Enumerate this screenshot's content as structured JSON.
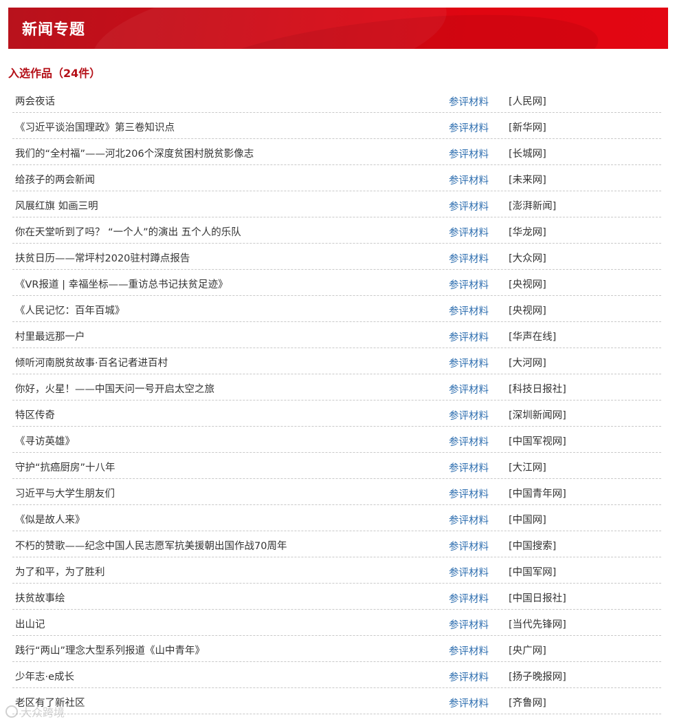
{
  "header": {
    "title": "新闻专题"
  },
  "section": {
    "title": "入选作品（24件）"
  },
  "items": [
    {
      "title": "两会夜话",
      "ref_label": "参评材料",
      "source": "[人民网]"
    },
    {
      "title": "《习近平谈治国理政》第三卷知识点",
      "ref_label": "参评材料",
      "source": "[新华网]"
    },
    {
      "title": "我们的“全村福”——河北206个深度贫困村脱贫影像志",
      "ref_label": "参评材料",
      "source": "[长城网]"
    },
    {
      "title": "给孩子的两会新闻",
      "ref_label": "参评材料",
      "source": "[未来网]"
    },
    {
      "title": "风展红旗 如画三明",
      "ref_label": "参评材料",
      "source": "[澎湃新闻]"
    },
    {
      "title": "你在天堂听到了吗？ “一个人”的演出 五个人的乐队",
      "ref_label": "参评材料",
      "source": "[华龙网]"
    },
    {
      "title": "扶贫日历——常坪村2020驻村蹲点报告",
      "ref_label": "参评材料",
      "source": "[大众网]"
    },
    {
      "title": "《VR报道 | 幸福坐标——重访总书记扶贫足迹》",
      "ref_label": "参评材料",
      "source": "[央视网]"
    },
    {
      "title": "《人民记忆：百年百城》",
      "ref_label": "参评材料",
      "source": "[央视网]"
    },
    {
      "title": "村里最远那一户",
      "ref_label": "参评材料",
      "source": "[华声在线]"
    },
    {
      "title": "倾听河南脱贫故事·百名记者进百村",
      "ref_label": "参评材料",
      "source": "[大河网]"
    },
    {
      "title": "你好，火星！——中国天问一号开启太空之旅",
      "ref_label": "参评材料",
      "source": "[科技日报社]"
    },
    {
      "title": "特区传奇",
      "ref_label": "参评材料",
      "source": "[深圳新闻网]"
    },
    {
      "title": "《寻访英雄》",
      "ref_label": "参评材料",
      "source": "[中国军视网]"
    },
    {
      "title": "守护“抗癌厨房”十八年",
      "ref_label": "参评材料",
      "source": "[大江网]"
    },
    {
      "title": "习近平与大学生朋友们",
      "ref_label": "参评材料",
      "source": "[中国青年网]"
    },
    {
      "title": "《似是故人来》",
      "ref_label": "参评材料",
      "source": "[中国网]"
    },
    {
      "title": "不朽的赞歌——纪念中国人民志愿军抗美援朝出国作战70周年",
      "ref_label": "参评材料",
      "source": "[中国搜索]"
    },
    {
      "title": "为了和平，为了胜利",
      "ref_label": "参评材料",
      "source": "[中国军网]"
    },
    {
      "title": "扶贫故事绘",
      "ref_label": "参评材料",
      "source": "[中国日报社]"
    },
    {
      "title": "出山记",
      "ref_label": "参评材料",
      "source": "[当代先锋网]"
    },
    {
      "title": "践行“两山”理念大型系列报道《山中青年》",
      "ref_label": "参评材料",
      "source": "[央广网]"
    },
    {
      "title": "少年志·e成长",
      "ref_label": "参评材料",
      "source": "[扬子晚报网]"
    },
    {
      "title": "老区有了新社区",
      "ref_label": "参评材料",
      "source": "[齐鲁网]"
    }
  ],
  "watermark": {
    "text": "大众跨境"
  },
  "colors": {
    "header_red": "#d10a16",
    "section_title_red": "#b40f17",
    "link_blue": "#2f6fb0",
    "divider": "#c8c8c8"
  }
}
